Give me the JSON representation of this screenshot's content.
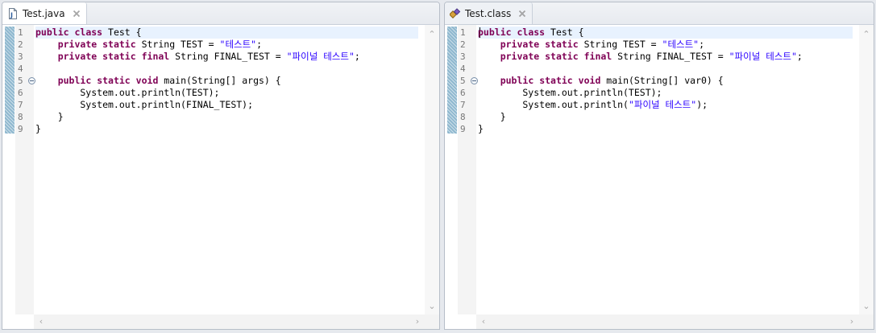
{
  "editors": [
    {
      "tab_title": "Test.java",
      "tab_icon": "java-file-icon",
      "code_lines": [
        [
          {
            "t": "public",
            "c": "kw"
          },
          {
            "t": " "
          },
          {
            "t": "class",
            "c": "kw"
          },
          {
            "t": " Test {"
          }
        ],
        [
          {
            "t": "    "
          },
          {
            "t": "private",
            "c": "kw"
          },
          {
            "t": " "
          },
          {
            "t": "static",
            "c": "kw"
          },
          {
            "t": " String TEST = "
          },
          {
            "t": "\"테스트\"",
            "c": "str"
          },
          {
            "t": ";"
          }
        ],
        [
          {
            "t": "    "
          },
          {
            "t": "private",
            "c": "kw"
          },
          {
            "t": " "
          },
          {
            "t": "static",
            "c": "kw"
          },
          {
            "t": " "
          },
          {
            "t": "final",
            "c": "kw"
          },
          {
            "t": " String FINAL_TEST = "
          },
          {
            "t": "\"파이널 테스트\"",
            "c": "str"
          },
          {
            "t": ";"
          }
        ],
        [],
        [
          {
            "t": "    "
          },
          {
            "t": "public",
            "c": "kw"
          },
          {
            "t": " "
          },
          {
            "t": "static",
            "c": "kw"
          },
          {
            "t": " "
          },
          {
            "t": "void",
            "c": "kw"
          },
          {
            "t": " main(String[] args) {"
          }
        ],
        [
          {
            "t": "        System.out.println(TEST);"
          }
        ],
        [
          {
            "t": "        System.out.println(FINAL_TEST);"
          }
        ],
        [
          {
            "t": "    }"
          }
        ],
        [
          {
            "t": "}"
          }
        ]
      ]
    },
    {
      "tab_title": "Test.class",
      "tab_icon": "class-file-icon",
      "code_lines": [
        [
          {
            "t": "public",
            "c": "kw"
          },
          {
            "t": " "
          },
          {
            "t": "class",
            "c": "kw"
          },
          {
            "t": " Test {"
          }
        ],
        [
          {
            "t": "    "
          },
          {
            "t": "private",
            "c": "kw"
          },
          {
            "t": " "
          },
          {
            "t": "static",
            "c": "kw"
          },
          {
            "t": " String TEST = "
          },
          {
            "t": "\"테스트\"",
            "c": "str"
          },
          {
            "t": ";"
          }
        ],
        [
          {
            "t": "    "
          },
          {
            "t": "private",
            "c": "kw"
          },
          {
            "t": " "
          },
          {
            "t": "static",
            "c": "kw"
          },
          {
            "t": " "
          },
          {
            "t": "final",
            "c": "kw"
          },
          {
            "t": " String FINAL_TEST = "
          },
          {
            "t": "\"파이널 테스트\"",
            "c": "str"
          },
          {
            "t": ";"
          }
        ],
        [],
        [
          {
            "t": "    "
          },
          {
            "t": "public",
            "c": "kw"
          },
          {
            "t": " "
          },
          {
            "t": "static",
            "c": "kw"
          },
          {
            "t": " "
          },
          {
            "t": "void",
            "c": "kw"
          },
          {
            "t": " main(String[] var0) {"
          }
        ],
        [
          {
            "t": "        System.out.println(TEST);"
          }
        ],
        [
          {
            "t": "        System.out.println("
          },
          {
            "t": "\"파이널 테스트\"",
            "c": "str"
          },
          {
            "t": ");"
          }
        ],
        [
          {
            "t": "    }"
          }
        ],
        [
          {
            "t": "}"
          }
        ]
      ]
    }
  ],
  "line_numbers": [
    "1",
    "2",
    "3",
    "4",
    "5",
    "6",
    "7",
    "8",
    "9"
  ],
  "fold_line": 5,
  "colors": {
    "keyword": "#7f0055",
    "string": "#2a00ff",
    "current_line": "#e8f2fe",
    "ruler": "#8fb8cf"
  },
  "scroll_glyphs": {
    "up": "⌃",
    "down": "⌄",
    "left": "‹",
    "right": "›"
  }
}
